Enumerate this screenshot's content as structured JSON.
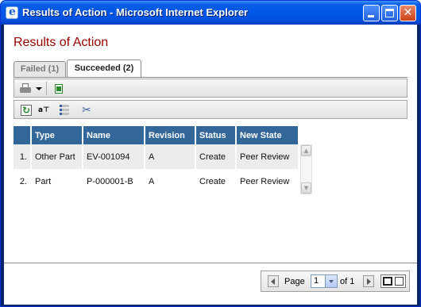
{
  "window": {
    "title": "Results of Action - Microsoft Internet Explorer",
    "close_glyph": "✕"
  },
  "page": {
    "title": "Results of Action"
  },
  "tabs": [
    {
      "label": "Failed (1)",
      "selected": false
    },
    {
      "label": "Succeeded (2)",
      "selected": true
    }
  ],
  "toolbar": {
    "row1_icons": [
      "printer-icon",
      "dropdown-arrow-icon",
      "export-icon"
    ],
    "row2_icons": [
      "refresh-icon",
      "filter-icon",
      "columns-icon",
      "tools-icon"
    ],
    "refresh_glyph": "↻",
    "filter_glyph": "a⊤",
    "tools_glyph": "✂"
  },
  "table": {
    "headers": [
      "",
      "Type",
      "Name",
      "Revision",
      "Status",
      "New State"
    ],
    "rows": [
      {
        "num": "1.",
        "type": "Other Part",
        "name": "EV-001094",
        "revision": "A",
        "status": "Create",
        "new_state": "Peer Review"
      },
      {
        "num": "2.",
        "type": "Part",
        "name": "P-000001-B",
        "revision": "A",
        "status": "Create",
        "new_state": "Peer Review"
      }
    ],
    "scroll_up_glyph": "▲",
    "scroll_down_glyph": "▼"
  },
  "pager": {
    "page_label": "Page",
    "current_page": "1",
    "of_label": "of 1"
  },
  "colors": {
    "title_color": "#990000",
    "header_bg": "#336699",
    "titlebar": "#0054e3"
  }
}
